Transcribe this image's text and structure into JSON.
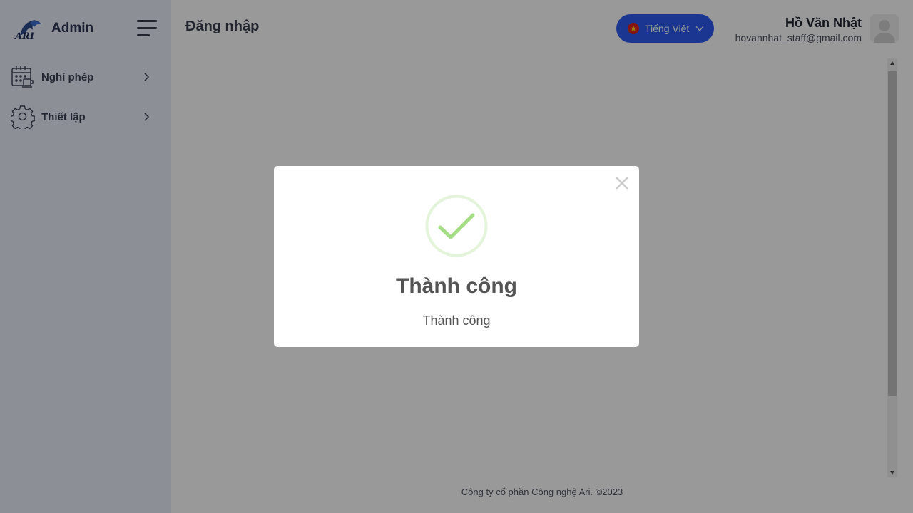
{
  "brand": {
    "name": "Admin",
    "logo_icon": "ari-logo-icon"
  },
  "sidebar": {
    "items": [
      {
        "label": "Nghỉ phép",
        "icon": "calendar-icon"
      },
      {
        "label": "Thiết lập",
        "icon": "gear-icon"
      }
    ]
  },
  "header": {
    "title": "Đăng nhập",
    "language": {
      "label": "Tiếng Việt",
      "flag": "vietnam-flag-icon"
    },
    "user": {
      "name": "Hồ Văn Nhật",
      "email": "hovannhat_staff@gmail.com"
    }
  },
  "footer": {
    "text": "Công ty cổ phần Công nghệ Ari. ©2023"
  },
  "dialog": {
    "title": "Thành công",
    "message": "Thành công",
    "icon": "success-check-icon",
    "close_symbol": "×"
  },
  "colors": {
    "accent": "#2c5bf2",
    "sidebar_bg": "#e9eef9",
    "success": "#a5dc86",
    "overlay": "rgba(0,0,0,0.4)"
  }
}
